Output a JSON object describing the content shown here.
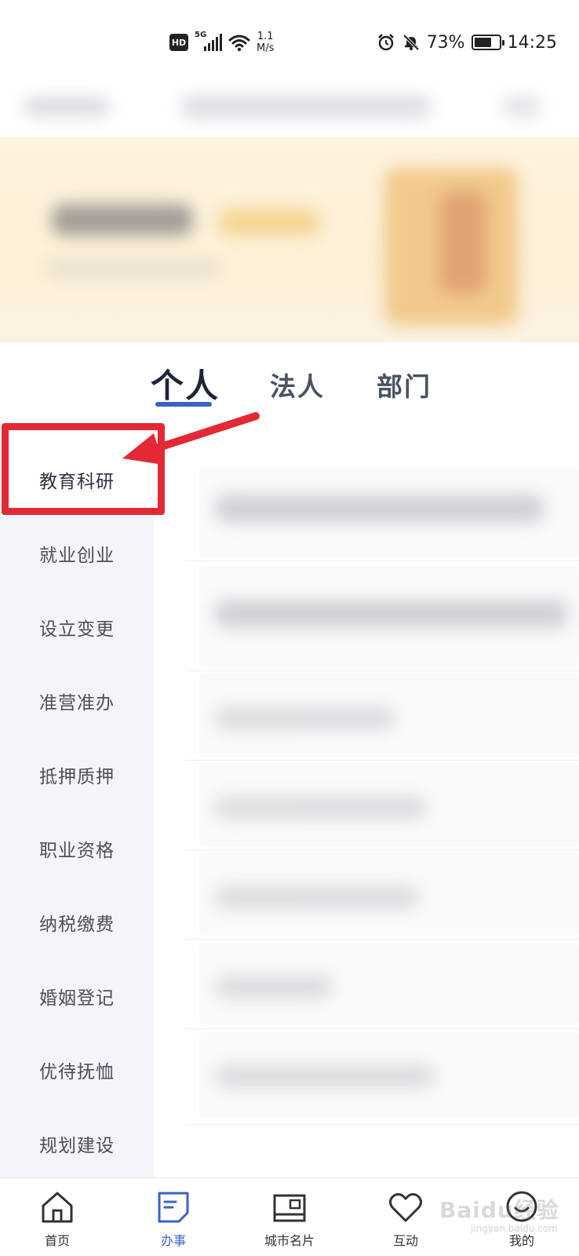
{
  "status_bar": {
    "network": "5G",
    "hd": "HD",
    "speed_value": "1.1",
    "speed_unit": "M/s",
    "battery": "73%",
    "battery_level": 0.73,
    "time": "14:25"
  },
  "tabs": [
    {
      "label": "个人",
      "active": true
    },
    {
      "label": "法人",
      "active": false
    },
    {
      "label": "部门",
      "active": false
    }
  ],
  "sidebar": {
    "items": [
      {
        "label": "教育科研",
        "selected": true
      },
      {
        "label": "就业创业",
        "selected": false
      },
      {
        "label": "设立变更",
        "selected": false
      },
      {
        "label": "准营准办",
        "selected": false
      },
      {
        "label": "抵押质押",
        "selected": false
      },
      {
        "label": "职业资格",
        "selected": false
      },
      {
        "label": "纳税缴费",
        "selected": false
      },
      {
        "label": "婚姻登记",
        "selected": false
      },
      {
        "label": "优待抚恤",
        "selected": false
      },
      {
        "label": "规划建设",
        "selected": false
      }
    ]
  },
  "bottom_nav": {
    "items": [
      {
        "label": "首页",
        "icon": "home-icon",
        "active": false
      },
      {
        "label": "办事",
        "icon": "document-icon",
        "active": true
      },
      {
        "label": "城市名片",
        "icon": "card-icon",
        "active": false
      },
      {
        "label": "互动",
        "icon": "heart-icon",
        "active": false
      },
      {
        "label": "我的",
        "icon": "profile-icon",
        "active": false
      }
    ]
  },
  "watermark": {
    "text": "Baidu经验",
    "sub": "jingyan.baidu.com"
  },
  "colors": {
    "accent": "#3a62c8",
    "annotation": "#e32935",
    "sidebar_bg": "#f4f5f8"
  }
}
